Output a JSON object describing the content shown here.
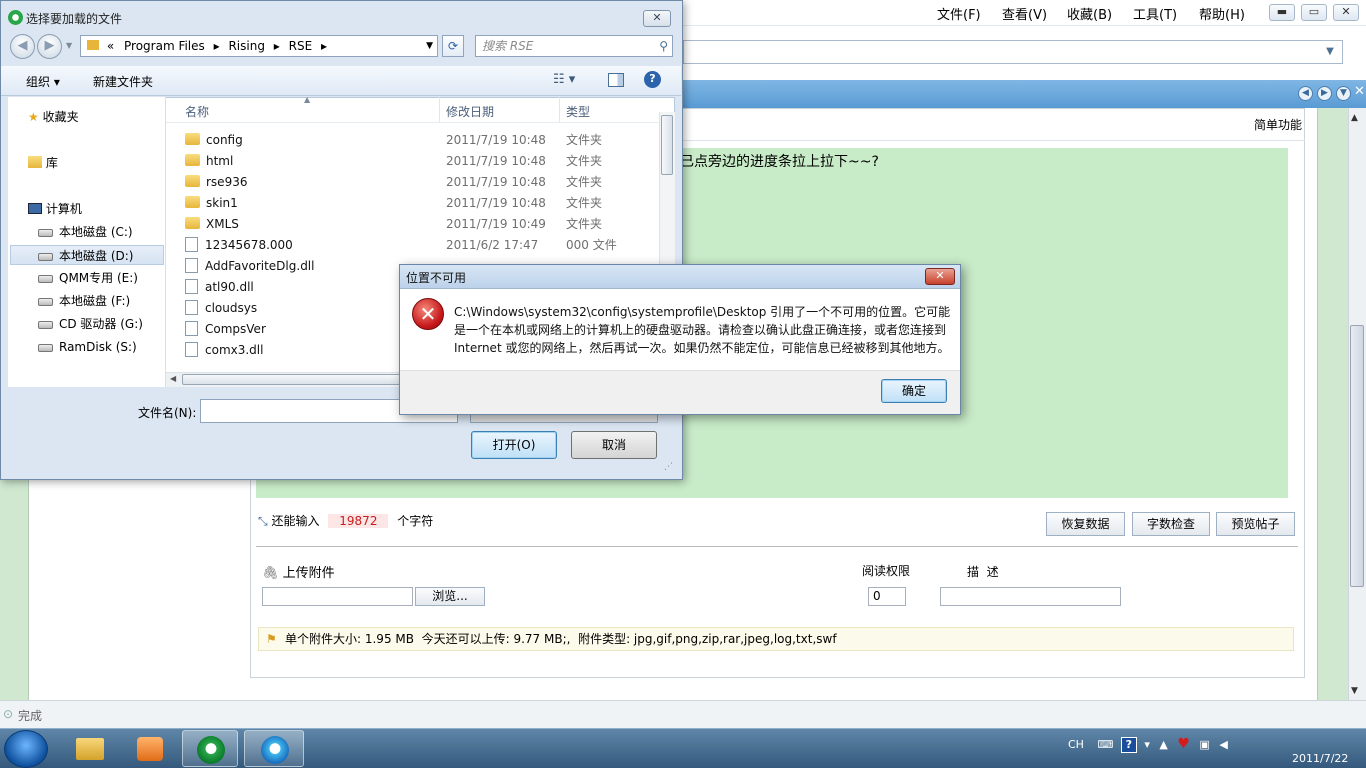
{
  "browser": {
    "menu": {
      "file": "文件(F)",
      "view": "查看(V)",
      "favorites": "收藏(B)",
      "tools": "工具(T)",
      "help": "帮助(H)"
    },
    "window_buttons": {
      "minimize": "▬",
      "restore": "▭",
      "close": "✕"
    },
    "status": "完成"
  },
  "editor": {
    "simple_func": "简单功能",
    "content_text": "已点旁边的进度条拉上拉下~~?",
    "remain_label": "还能输入",
    "remain_count": "19872",
    "remain_unit": "个字符",
    "buttons": {
      "restore": "恢复数据",
      "count": "字数检查",
      "preview": "预览帖子"
    },
    "upload_label": "上传附件",
    "browse_button": "浏览...",
    "read_perm_label": "阅读权限",
    "read_perm_value": "0",
    "desc_label": "描  述",
    "attach_info": "单个附件大小: 1.95 MB  今天还可以上传: 9.77 MB;,  附件类型: jpg,gif,png,zip,rar,jpeg,log,txt,swf"
  },
  "file_dialog": {
    "title": "选择要加载的文件",
    "path": {
      "prefix": "«",
      "seg1": "Program Files",
      "seg2": "Rising",
      "seg3": "RSE"
    },
    "search_placeholder": "搜索 RSE",
    "toolbar": {
      "organize": "组织 ▾",
      "new_folder": "新建文件夹"
    },
    "nav": {
      "favorites": "收藏夹",
      "libraries": "库",
      "computer": "计算机",
      "drives": [
        "本地磁盘 (C:)",
        "本地磁盘 (D:)",
        "QMM专用 (E:)",
        "本地磁盘 (F:)",
        "CD 驱动器 (G:)",
        "RamDisk (S:)"
      ]
    },
    "columns": {
      "name": "名称",
      "date": "修改日期",
      "type": "类型"
    },
    "files": [
      {
        "name": "config",
        "date": "2011/7/19 10:48",
        "type": "文件夹",
        "kind": "folder"
      },
      {
        "name": "html",
        "date": "2011/7/19 10:48",
        "type": "文件夹",
        "kind": "folder"
      },
      {
        "name": "rse936",
        "date": "2011/7/19 10:48",
        "type": "文件夹",
        "kind": "folder"
      },
      {
        "name": "skin1",
        "date": "2011/7/19 10:48",
        "type": "文件夹",
        "kind": "folder"
      },
      {
        "name": "XMLS",
        "date": "2011/7/19 10:49",
        "type": "文件夹",
        "kind": "folder"
      },
      {
        "name": "12345678.000",
        "date": "2011/6/2 17:47",
        "type": "000 文件",
        "kind": "file"
      },
      {
        "name": "AddFavoriteDlg.dll",
        "date": "",
        "type": "",
        "kind": "file"
      },
      {
        "name": "atl90.dll",
        "date": "",
        "type": "",
        "kind": "file"
      },
      {
        "name": "cloudsys",
        "date": "",
        "type": "",
        "kind": "file"
      },
      {
        "name": "CompsVer",
        "date": "",
        "type": "",
        "kind": "file"
      },
      {
        "name": "comx3.dll",
        "date": "",
        "type": "",
        "kind": "file"
      }
    ],
    "filename_label": "文件名(N):",
    "open_button": "打开(O)",
    "cancel_button": "取消"
  },
  "alert": {
    "title": "位置不可用",
    "message": "C:\\Windows\\system32\\config\\systemprofile\\Desktop 引用了一个不可用的位置。它可能是一个在本机或网络上的计算机上的硬盘驱动器。请检查以确认此盘正确连接，或者您连接到 Internet 或您的网络上，然后再试一次。如果仍然不能定位，可能信息已经被移到其他地方。",
    "ok_button": "确定",
    "icon": "error-icon"
  },
  "taskbar": {
    "tray_lang": "CH",
    "date": "2011/7/22"
  }
}
